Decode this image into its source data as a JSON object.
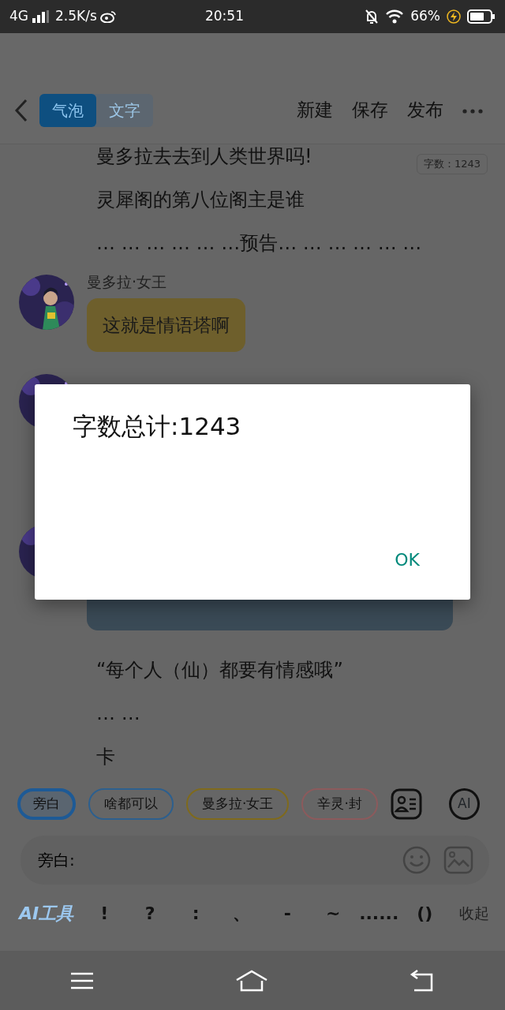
{
  "status_bar": {
    "network": "4G",
    "speed": "2.5K/s",
    "time": "20:51",
    "battery": "66%"
  },
  "header": {
    "modes": [
      {
        "label": "气泡",
        "selected": true
      },
      {
        "label": "文字",
        "selected": false
      }
    ],
    "actions": [
      "新建",
      "保存",
      "发布"
    ]
  },
  "word_count": "字数：1243",
  "script": [
    {
      "kind": "line",
      "text": "曼多拉去去到人类世界吗!"
    },
    {
      "kind": "line",
      "text": "灵犀阁的第八位阁主是谁"
    },
    {
      "kind": "line",
      "text": "… … … … … …预告… … … … … …"
    },
    {
      "kind": "message",
      "speaker": "曼多拉·女王",
      "text": "这就是情语塔啊",
      "color": "#6e5f2c"
    },
    {
      "kind": "message"
    },
    {
      "kind": "message",
      "color": "#3a4a56"
    },
    {
      "kind": "line",
      "text": "“每个人（仙）都要有情感哦”"
    },
    {
      "kind": "line",
      "text": "… …"
    },
    {
      "kind": "line",
      "text": "卡"
    }
  ],
  "roles": [
    {
      "label": "旁白",
      "color": "#1d5a96",
      "selected": true
    },
    {
      "label": "啥都可以",
      "color": "#2c5f8e",
      "selected": false
    },
    {
      "label": "曼多拉·女王",
      "color": "#7f6a1c",
      "selected": false
    },
    {
      "label": "辛灵·封",
      "color": "#8c5a5c",
      "selected": false
    }
  ],
  "ai_button": "AI",
  "input": {
    "value": "旁白:"
  },
  "toolbar": {
    "ai_tools": "AI工具",
    "punctuation": [
      "!",
      "?",
      ":",
      "、",
      "-",
      "~",
      "......",
      "()"
    ],
    "collapse": "收起"
  },
  "dialog": {
    "message": "字数总计:1243",
    "button": "OK"
  }
}
